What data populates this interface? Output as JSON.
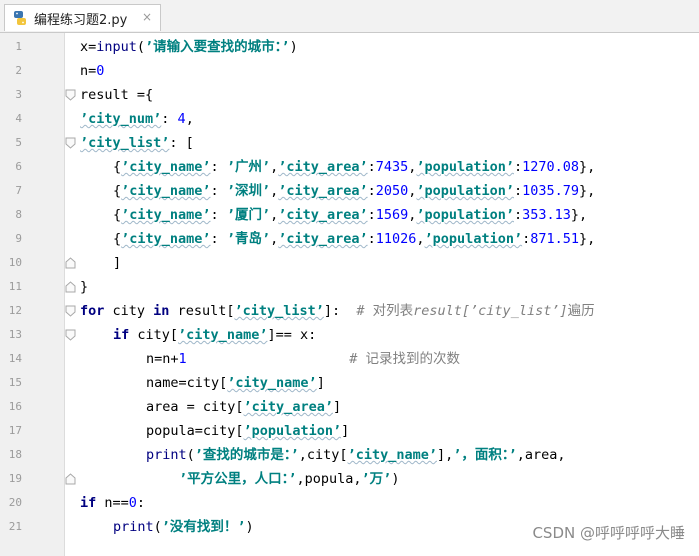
{
  "tab": {
    "filename": "编程练习题2.py",
    "close_glyph": "×",
    "icon": "python-file-icon"
  },
  "watermark": "CSDN @呼呼呼呼大睡",
  "lines": [
    {
      "n": "1",
      "indent": 0,
      "fold": "",
      "tokens": [
        [
          "x=",
          "t"
        ],
        [
          "input",
          "bi"
        ],
        [
          "(",
          "t"
        ],
        [
          "’请输入要查找的城市：’",
          "str"
        ],
        [
          ")",
          "t"
        ]
      ]
    },
    {
      "n": "2",
      "indent": 0,
      "fold": "",
      "tokens": [
        [
          "n=",
          "t"
        ],
        [
          "0",
          "num"
        ]
      ]
    },
    {
      "n": "3",
      "indent": 0,
      "fold": "open",
      "tokens": [
        [
          "result ={",
          "t"
        ]
      ]
    },
    {
      "n": "4",
      "indent": 0,
      "fold": "",
      "tokens": [
        [
          "’city_num’",
          "str"
        ],
        [
          ": ",
          "t"
        ],
        [
          "4",
          "num"
        ],
        [
          ",",
          "t"
        ]
      ]
    },
    {
      "n": "5",
      "indent": 0,
      "fold": "open",
      "tokens": [
        [
          "’city_list’",
          "str"
        ],
        [
          ": [",
          "t"
        ]
      ]
    },
    {
      "n": "6",
      "indent": 1,
      "fold": "",
      "tokens": [
        [
          "{",
          "t"
        ],
        [
          "’city_name’",
          "str"
        ],
        [
          ": ",
          "t"
        ],
        [
          "’广州’",
          "str"
        ],
        [
          ",",
          "t"
        ],
        [
          "’city_area’",
          "str"
        ],
        [
          ":",
          "t"
        ],
        [
          "7435",
          "num"
        ],
        [
          ",",
          "t"
        ],
        [
          "’population’",
          "str"
        ],
        [
          ":",
          "t"
        ],
        [
          "1270.08",
          "num"
        ],
        [
          "},",
          "t"
        ]
      ]
    },
    {
      "n": "7",
      "indent": 1,
      "fold": "",
      "tokens": [
        [
          "{",
          "t"
        ],
        [
          "’city_name’",
          "str"
        ],
        [
          ": ",
          "t"
        ],
        [
          "’深圳’",
          "str"
        ],
        [
          ",",
          "t"
        ],
        [
          "’city_area’",
          "str"
        ],
        [
          ":",
          "t"
        ],
        [
          "2050",
          "num"
        ],
        [
          ",",
          "t"
        ],
        [
          "’population’",
          "str"
        ],
        [
          ":",
          "t"
        ],
        [
          "1035.79",
          "num"
        ],
        [
          "},",
          "t"
        ]
      ]
    },
    {
      "n": "8",
      "indent": 1,
      "fold": "",
      "tokens": [
        [
          "{",
          "t"
        ],
        [
          "’city_name’",
          "str"
        ],
        [
          ": ",
          "t"
        ],
        [
          "’厦门’",
          "str"
        ],
        [
          ",",
          "t"
        ],
        [
          "’city_area’",
          "str"
        ],
        [
          ":",
          "t"
        ],
        [
          "1569",
          "num"
        ],
        [
          ",",
          "t"
        ],
        [
          "’population’",
          "str"
        ],
        [
          ":",
          "t"
        ],
        [
          "353.13",
          "num"
        ],
        [
          "},",
          "t"
        ]
      ]
    },
    {
      "n": "9",
      "indent": 1,
      "fold": "",
      "tokens": [
        [
          "{",
          "t"
        ],
        [
          "’city_name’",
          "str"
        ],
        [
          ": ",
          "t"
        ],
        [
          "’青岛’",
          "str"
        ],
        [
          ",",
          "t"
        ],
        [
          "’city_area’",
          "str"
        ],
        [
          ":",
          "t"
        ],
        [
          "11026",
          "num"
        ],
        [
          ",",
          "t"
        ],
        [
          "’population’",
          "str"
        ],
        [
          ":",
          "t"
        ],
        [
          "871.51",
          "num"
        ],
        [
          "},",
          "t"
        ]
      ]
    },
    {
      "n": "10",
      "indent": 1,
      "fold": "close",
      "tokens": [
        [
          "]",
          "t"
        ]
      ]
    },
    {
      "n": "11",
      "indent": 0,
      "fold": "close",
      "tokens": [
        [
          "}",
          "t"
        ]
      ]
    },
    {
      "n": "12",
      "indent": 0,
      "fold": "open",
      "tokens": [
        [
          "for",
          "kw"
        ],
        [
          " city ",
          "t"
        ],
        [
          "in",
          "kw"
        ],
        [
          " result[",
          "t"
        ],
        [
          "’city_list’",
          "str"
        ],
        [
          "]:  ",
          "t"
        ],
        [
          "# 对列表",
          "cm"
        ],
        [
          "result[’city_list’]",
          "cmi"
        ],
        [
          "遍历",
          "cm"
        ]
      ]
    },
    {
      "n": "13",
      "indent": 1,
      "fold": "open",
      "tokens": [
        [
          "if",
          "kw"
        ],
        [
          " city[",
          "t"
        ],
        [
          "’city_name’",
          "str"
        ],
        [
          "]== x:",
          "t"
        ]
      ]
    },
    {
      "n": "14",
      "indent": 2,
      "fold": "",
      "tokens": [
        [
          "n=n+",
          "t"
        ],
        [
          "1",
          "num"
        ],
        [
          "                    ",
          "t"
        ],
        [
          "# 记录找到的次数",
          "cm"
        ]
      ]
    },
    {
      "n": "15",
      "indent": 2,
      "fold": "",
      "tokens": [
        [
          "name=city[",
          "t"
        ],
        [
          "’city_name’",
          "str"
        ],
        [
          "]",
          "t"
        ]
      ]
    },
    {
      "n": "16",
      "indent": 2,
      "fold": "",
      "tokens": [
        [
          "area = city[",
          "t"
        ],
        [
          "’city_area’",
          "str"
        ],
        [
          "]",
          "t"
        ]
      ]
    },
    {
      "n": "17",
      "indent": 2,
      "fold": "",
      "tokens": [
        [
          "popula=city[",
          "t"
        ],
        [
          "’population’",
          "str"
        ],
        [
          "]",
          "t"
        ]
      ]
    },
    {
      "n": "18",
      "indent": 2,
      "fold": "",
      "tokens": [
        [
          "print",
          "bi"
        ],
        [
          "(",
          "t"
        ],
        [
          "’查找的城市是：’",
          "str"
        ],
        [
          ",city[",
          "t"
        ],
        [
          "’city_name’",
          "str"
        ],
        [
          "],",
          "t"
        ],
        [
          "’，面积：’",
          "str"
        ],
        [
          ",area,",
          "t"
        ]
      ]
    },
    {
      "n": "19",
      "indent": 3,
      "fold": "close",
      "tokens": [
        [
          "’平方公里，人口：’",
          "str"
        ],
        [
          ",popula,",
          "t"
        ],
        [
          "’万’",
          "str"
        ],
        [
          ")",
          "t"
        ]
      ]
    },
    {
      "n": "20",
      "indent": 0,
      "fold": "",
      "tokens": [
        [
          "if",
          "kw"
        ],
        [
          " n==",
          "t"
        ],
        [
          "0",
          "num"
        ],
        [
          ":",
          "t"
        ]
      ]
    },
    {
      "n": "21",
      "indent": 1,
      "fold": "",
      "tokens": [
        [
          "print",
          "bi"
        ],
        [
          "(",
          "t"
        ],
        [
          "’没有找到！’",
          "str"
        ],
        [
          ")",
          "t"
        ]
      ]
    }
  ]
}
